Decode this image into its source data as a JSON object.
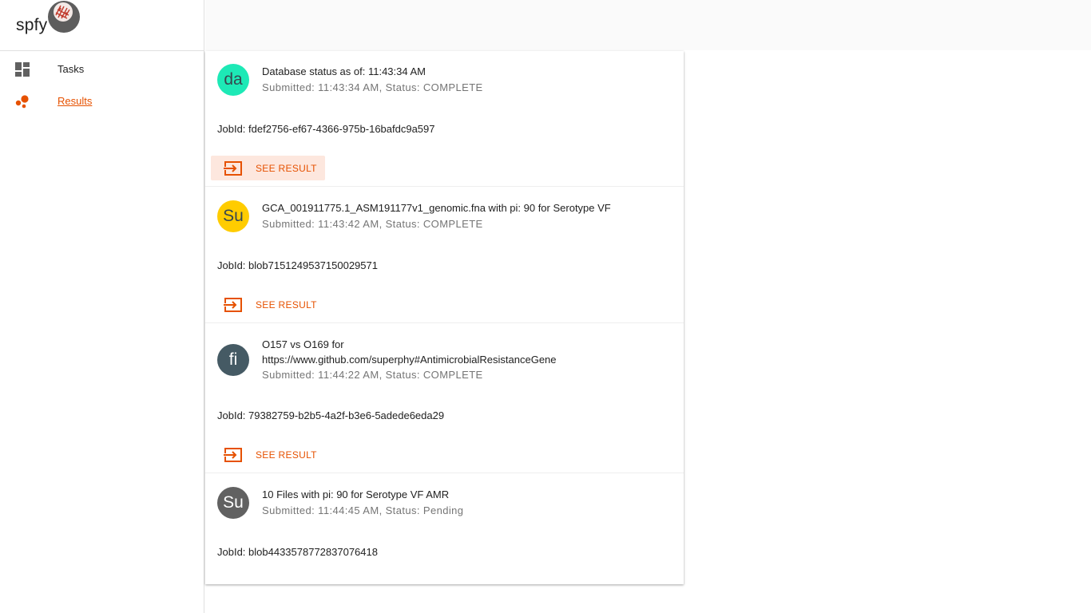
{
  "app": {
    "title": "spfy"
  },
  "colors": {
    "accent": "#e65100",
    "avatar_teal": "#1de9b6",
    "avatar_amber": "#ffcc00",
    "avatar_slate": "#455a64",
    "avatar_grey": "#616161"
  },
  "sidebar": {
    "items": [
      {
        "label": "Tasks",
        "icon": "dashboard-icon"
      },
      {
        "label": "Results",
        "icon": "bubble-chart-icon"
      }
    ]
  },
  "results": [
    {
      "avatar": "da",
      "title": "Database status as of: 11:43:34 AM",
      "subtitle": "Submitted: 11:43:34 AM, Status: COMPLETE",
      "jobid": "JobId: fdef2756-ef67-4366-975b-16bafdc9a597",
      "button": "SEE RESULT"
    },
    {
      "avatar": "Su",
      "title": "GCA_001911775.1_ASM191177v1_genomic.fna with pi: 90 for Serotype VF",
      "subtitle": "Submitted: 11:43:42 AM, Status: COMPLETE",
      "jobid": "JobId: blob7151249537150029571",
      "button": "SEE RESULT"
    },
    {
      "avatar": "fi",
      "title_line1": "O157 vs O169 for",
      "title_line2": "https://www.github.com/superphy#AntimicrobialResistanceGene",
      "subtitle": "Submitted: 11:44:22 AM, Status: COMPLETE",
      "jobid": "JobId: 79382759-b2b5-4a2f-b3e6-5adede6eda29",
      "button": "SEE RESULT"
    },
    {
      "avatar": "Su",
      "title": "10 Files with pi: 90 for Serotype VF AMR",
      "subtitle": "Submitted: 11:44:45 AM, Status: Pending",
      "jobid": "JobId: blob4433578772837076418"
    }
  ]
}
